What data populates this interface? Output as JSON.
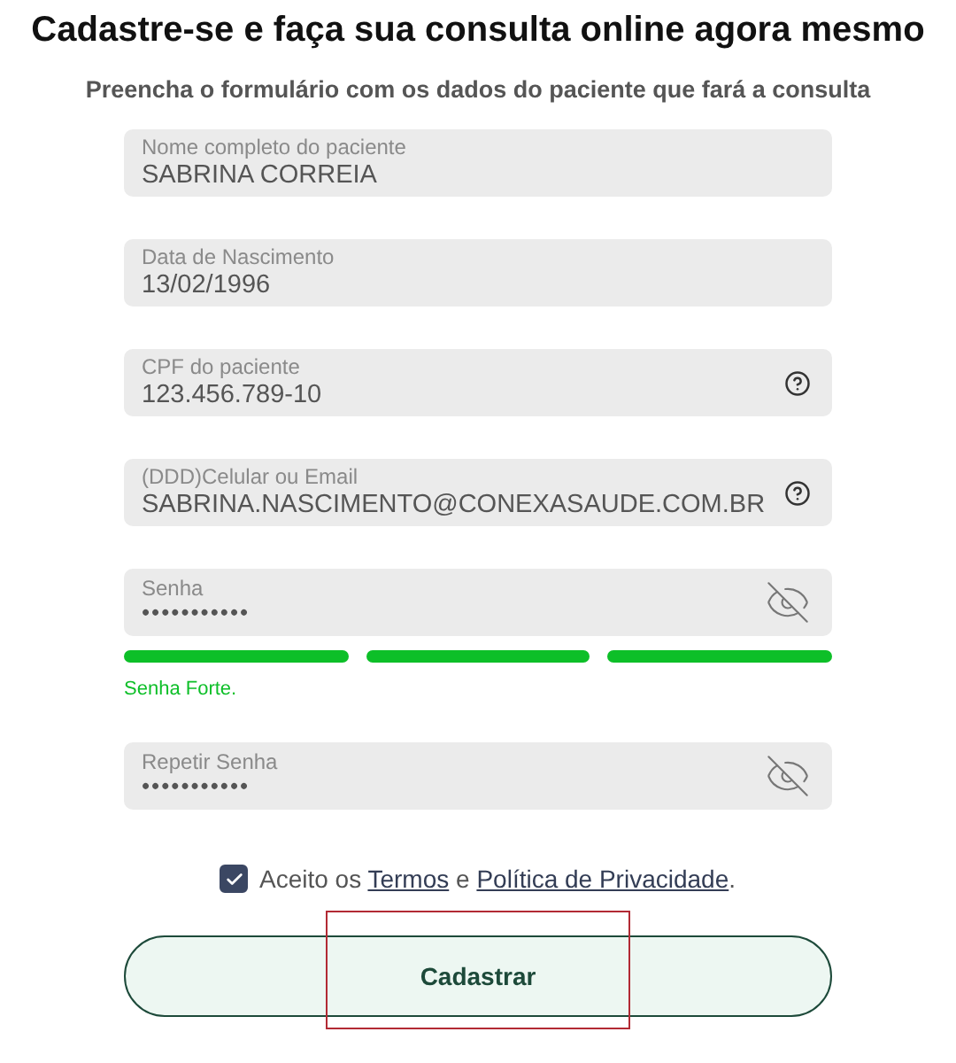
{
  "title": "Cadastre-se e faça sua consulta online agora mesmo",
  "subtitle": "Preencha o formulário com os dados do paciente que fará a consulta",
  "fields": [
    {
      "kind": "text",
      "label": "Nome completo do paciente",
      "value": "SABRINA CORREIA"
    },
    {
      "kind": "text",
      "label": "Data de Nascimento",
      "value": "13/02/1996"
    },
    {
      "kind": "help",
      "label": "CPF do paciente",
      "value": "123.456.789-10"
    },
    {
      "kind": "help",
      "label": "(DDD)Celular ou Email",
      "value": "SABRINA.NASCIMENTO@CONEXASAUDE.COM.BR"
    },
    {
      "kind": "password",
      "label": "Senha",
      "value": "•••••••••••",
      "strength": {
        "segments": [
          {
            "filled": true
          },
          {
            "filled": true
          },
          {
            "filled": true
          }
        ],
        "text": "Senha Forte."
      }
    },
    {
      "kind": "password",
      "label": "Repetir Senha",
      "value": "•••••••••••"
    }
  ],
  "terms": {
    "checked": true,
    "parts": [
      {
        "kind": "text",
        "text": "Aceito os "
      },
      {
        "kind": "link",
        "text": "Termos"
      },
      {
        "kind": "text",
        "text": " e "
      },
      {
        "kind": "link",
        "text": "Política de Privacidade"
      },
      {
        "kind": "text",
        "text": "."
      }
    ]
  },
  "submit": {
    "label": "Cadastrar",
    "highlighted": true
  }
}
